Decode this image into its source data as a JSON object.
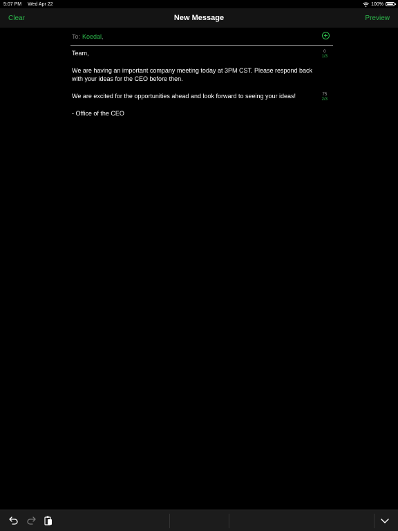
{
  "status_bar": {
    "time": "5:07 PM",
    "date": "Wed Apr 22",
    "battery": "100%"
  },
  "nav": {
    "clear_label": "Clear",
    "title": "New Message",
    "preview_label": "Preview"
  },
  "compose": {
    "to_label": "To:",
    "recipient": "Koedal",
    "recipient_separator": ",",
    "paragraphs": [
      {
        "text": "Team,",
        "counter_top": "0",
        "counter_bottom": "1/3"
      },
      {
        "text": "We are having an important company meeting today at 3PM CST. Please respond back with your ideas for the CEO before then.",
        "counter_top": "",
        "counter_bottom": ""
      },
      {
        "text": "We are excited for the opportunities ahead and look forward to seeing your ideas!",
        "counter_top": "75",
        "counter_bottom": "2/3"
      },
      {
        "text": "- Office of the CEO",
        "counter_top": "",
        "counter_bottom": ""
      }
    ]
  },
  "colors": {
    "accent": "#2db84c",
    "background": "#000000",
    "nav_background": "#141414",
    "toolbar_background": "#1c1c1c"
  },
  "toolbar": {
    "icons": [
      "undo-icon",
      "redo-icon",
      "paste-icon",
      "chevron-down-icon"
    ]
  }
}
